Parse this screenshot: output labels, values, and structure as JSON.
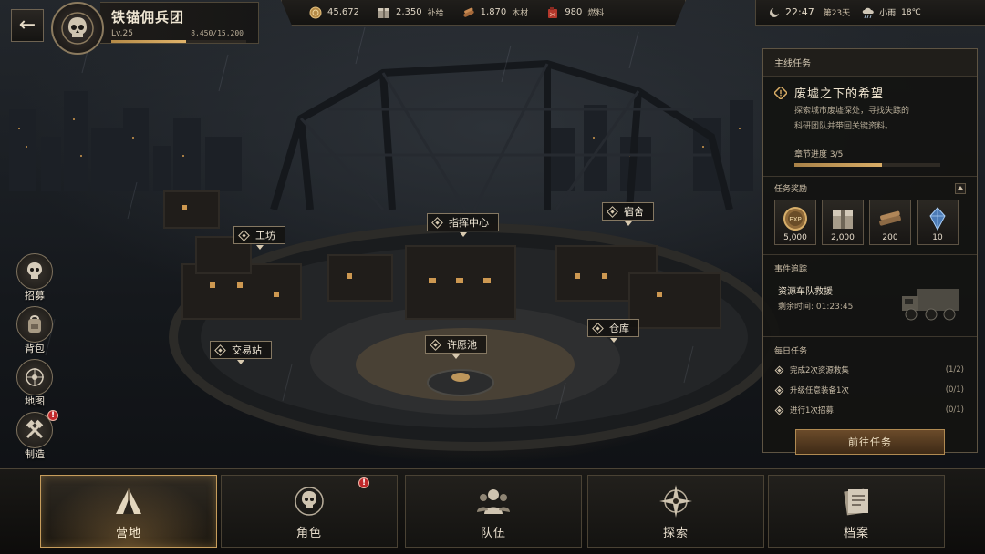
{
  "profile": {
    "guild_name": "铁锚佣兵团",
    "level": "Lv.25",
    "exp_text": "8,450/15,200",
    "exp_fraction": 0.556
  },
  "resources": [
    {
      "icon": "coin-icon",
      "value": "45,672",
      "label": ""
    },
    {
      "icon": "supply-crate-icon",
      "value": "2,350",
      "label": "补给"
    },
    {
      "icon": "wood-icon",
      "value": "1,870",
      "label": "木材"
    },
    {
      "icon": "fuel-can-icon",
      "value": "980",
      "label": "燃料"
    }
  ],
  "status": {
    "time": "22:47",
    "day": "第23天",
    "weather": "小雨",
    "temperature": "18℃"
  },
  "side_menu": [
    {
      "label": "招募",
      "icon": "recruit-skull-icon",
      "badge": false
    },
    {
      "label": "背包",
      "icon": "backpack-icon",
      "badge": false
    },
    {
      "label": "地图",
      "icon": "map-compass-icon",
      "badge": false
    },
    {
      "label": "制造",
      "icon": "crafting-tools-icon",
      "badge": true
    }
  ],
  "map_labels": {
    "command": "指挥中心",
    "workshop": "工坊",
    "dorm": "宿舍",
    "trade": "交易站",
    "wish": "许愿池",
    "warehouse": "仓库"
  },
  "quest": {
    "header": "主线任务",
    "title": "废墟之下的希望",
    "desc_line1": "探索城市废墟深处，寻找失踪的",
    "desc_line2": "科研团队并带回关键资料。",
    "progress_label": "章节进度 3/5",
    "progress_fraction": 0.6,
    "rewards_label": "任务奖励",
    "expand_icon": "arrow-up-icon",
    "rewards": [
      {
        "icon": "exp-medal-icon",
        "amount": "5,000"
      },
      {
        "icon": "supply-crate-icon",
        "amount": "2,000"
      },
      {
        "icon": "wood-planks-icon",
        "amount": "200"
      },
      {
        "icon": "blue-crystal-icon",
        "amount": "10"
      }
    ]
  },
  "event": {
    "header": "事件追踪",
    "title": "资源车队救援",
    "time": "剩余时间: 01:23:45"
  },
  "daily": {
    "header": "每日任务",
    "tasks": [
      {
        "text": "完成2次资源救集",
        "count": "(1/2)"
      },
      {
        "text": "升级任意装备1次",
        "count": "(0/1)"
      },
      {
        "text": "进行1次招募",
        "count": "(0/1)"
      }
    ],
    "go_button": "前往任务"
  },
  "bottom_nav": [
    {
      "label": "营地",
      "icon": "camp-tent-icon",
      "active": true,
      "badge": false
    },
    {
      "label": "角色",
      "icon": "character-skull-icon",
      "active": false,
      "badge": true
    },
    {
      "label": "队伍",
      "icon": "team-icon",
      "active": false,
      "badge": false
    },
    {
      "label": "探索",
      "icon": "explore-compass-icon",
      "active": false,
      "badge": false
    },
    {
      "label": "档案",
      "icon": "archive-folder-icon",
      "active": false,
      "badge": false
    }
  ],
  "colors": {
    "accent_gold": "#d9ad66",
    "badge_red": "#c0282a",
    "panel_border": "#5e5443"
  }
}
